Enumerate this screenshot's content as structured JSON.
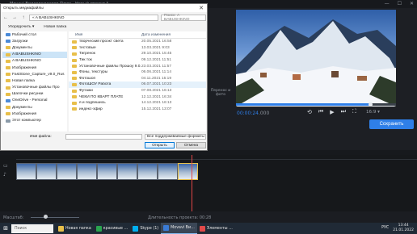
{
  "app": {
    "title": "Movavi Видеоредактор Плюс - Новый проект *"
  },
  "window_controls": {
    "minimize": "—",
    "maximize": "☐",
    "close": "✕"
  },
  "dialog": {
    "title": "Открыть медиафайлы",
    "close": "✕",
    "path": "« A BABUSHKINO",
    "search_placeholder": "Поиск: A BABUSHKINO",
    "toolbar": {
      "organize": "Упорядочить ▾",
      "new_folder": "Новая папка"
    },
    "tree": [
      {
        "label": "Рабочий стол",
        "icon": "desktop-icon"
      },
      {
        "label": "Загрузки",
        "icon": "download-icon"
      },
      {
        "label": "Документы",
        "icon": "documents-icon"
      },
      {
        "label": "A BABUSHKINO",
        "icon": "folder-icon",
        "selected": true
      },
      {
        "label": "A BABUSHKINO",
        "icon": "folder-icon"
      },
      {
        "label": "Изображения",
        "icon": "images-icon"
      },
      {
        "label": "FastStone_Capture_v9.0_Rus",
        "icon": "folder-icon"
      },
      {
        "label": "Новая папка",
        "icon": "folder-icon"
      },
      {
        "label": "Установочные файлы Про",
        "icon": "folder-icon"
      },
      {
        "label": "Шапочки рисунки",
        "icon": "folder-icon"
      },
      {
        "label": "OneDrive - Personal",
        "icon": "cloud-icon"
      },
      {
        "label": "Документы",
        "icon": "documents-icon"
      },
      {
        "label": "Изображения",
        "icon": "images-icon"
      },
      {
        "label": "Этот компьютер",
        "icon": "computer-icon"
      }
    ],
    "columns": {
      "name": "Имя",
      "date": "Дата изменения"
    },
    "files": [
      {
        "name": "творческий проэкт света",
        "date": "20.05.2021 16:58"
      },
      {
        "name": "тестовые",
        "date": "13.03.2021 9:03"
      },
      {
        "name": "Тигренок",
        "date": "29.10.2021 15:45"
      },
      {
        "name": "Тик ток",
        "date": "09.12.2021 11:51"
      },
      {
        "name": "Установочные файлы Прошоу 9.0.3797",
        "date": "23.03.2021 11:57"
      },
      {
        "name": "Фоны, текстуры",
        "date": "06.06.2021 11:14"
      },
      {
        "name": "Фотошоп",
        "date": "04.11.2021 15:19"
      },
      {
        "name": "ФотоШОУ Работа",
        "date": "06.07.2021 10:23",
        "highlight": true
      },
      {
        "name": "Футажи",
        "date": "07.08.2021 16:13"
      },
      {
        "name": "ЧЕКИ ПО КВАРТ ПЛАТЕ",
        "date": "12.12.2021 16:34"
      },
      {
        "name": "я и подпешись",
        "date": "14.12.2021 16:13"
      },
      {
        "name": "индекс-эфир",
        "date": "15.12.2021 13:07"
      }
    ],
    "filename_label": "Имя файла:",
    "filter": "Все поддерживаемые форматы",
    "open": "Открыть",
    "cancel": "Отмена"
  },
  "player": {
    "current_time": "00:00:24",
    "duration": ".000",
    "progress": 0.84,
    "volume": "16:9 ▾",
    "save": "Сохранить",
    "side_tools": "Перенос\nи фото",
    "controls": {
      "undo": "⟲",
      "prev": "⏮",
      "play": "▶",
      "next": "⏭",
      "fullscreen": "⛶"
    }
  },
  "timeline": {
    "clip_count": 9,
    "selected_index": 8
  },
  "status": {
    "scale_label": "Масштаб:",
    "project_duration": "Длительность проекта: 00:28",
    "zoom": 0.3
  },
  "taskbar": {
    "search": "Поиск",
    "apps": [
      {
        "label": "Новая папка",
        "color": "#e8bf4a"
      },
      {
        "label": "красивые …",
        "color": "#2aa44f"
      },
      {
        "label": "Skype (1)",
        "color": "#00aff0"
      },
      {
        "label": "Movavi Ви…",
        "color": "#3a7bd5",
        "active": true
      },
      {
        "label": "Элементы …",
        "color": "#e24a4a"
      }
    ],
    "lang": "РУС",
    "time": "13:44",
    "date": "21.01.2022"
  }
}
